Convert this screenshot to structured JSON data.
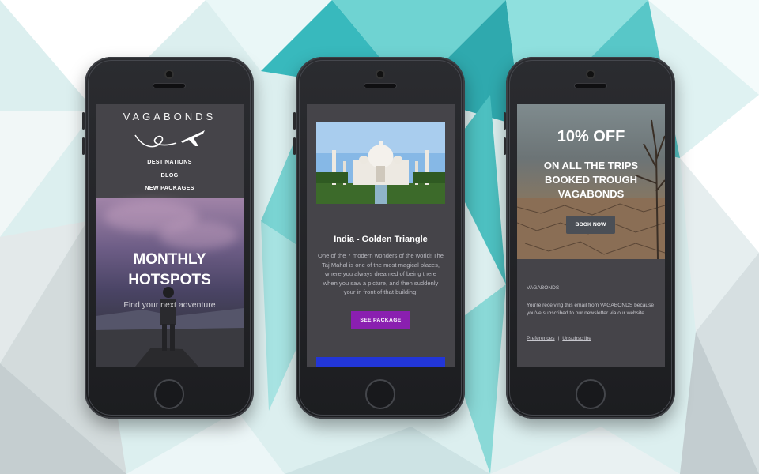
{
  "phone1": {
    "brand": "VAGABONDS",
    "nav": [
      "DESTINATIONS",
      "BLOG",
      "NEW PACKAGES"
    ],
    "hero_title_line1": "MONTHLY",
    "hero_title_line2": "HOTSPOTS",
    "hero_subtitle": "Find your next adventure"
  },
  "phone2": {
    "title": "India - Golden Triangle",
    "description": "One of the 7 modern wonders of the world! The Taj Mahal is one of the most magical places, where you always dreamed of being there when you saw a picture, and then suddenly your in front of that building!",
    "button": "SEE PACKAGE"
  },
  "phone3": {
    "discount": "10% OFF",
    "offer_line1": "ON ALL THE TRIPS",
    "offer_line2": "BOOKED TROUGH",
    "offer_line3": "VAGABONDS",
    "button": "BOOK NOW",
    "footer_brand": "VAGABONDS",
    "footer_text": "You're receiving this email from VAGABONDS because you've subscribed to our newsletter via our website.",
    "link_preferences": "Preferences",
    "link_separator": "|",
    "link_unsubscribe": "Unsubscribe"
  },
  "colors": {
    "screen_bg": "#454449",
    "accent_purple": "#8a1fb0",
    "accent_blue": "#2236d8",
    "phone_body": "#222327"
  }
}
